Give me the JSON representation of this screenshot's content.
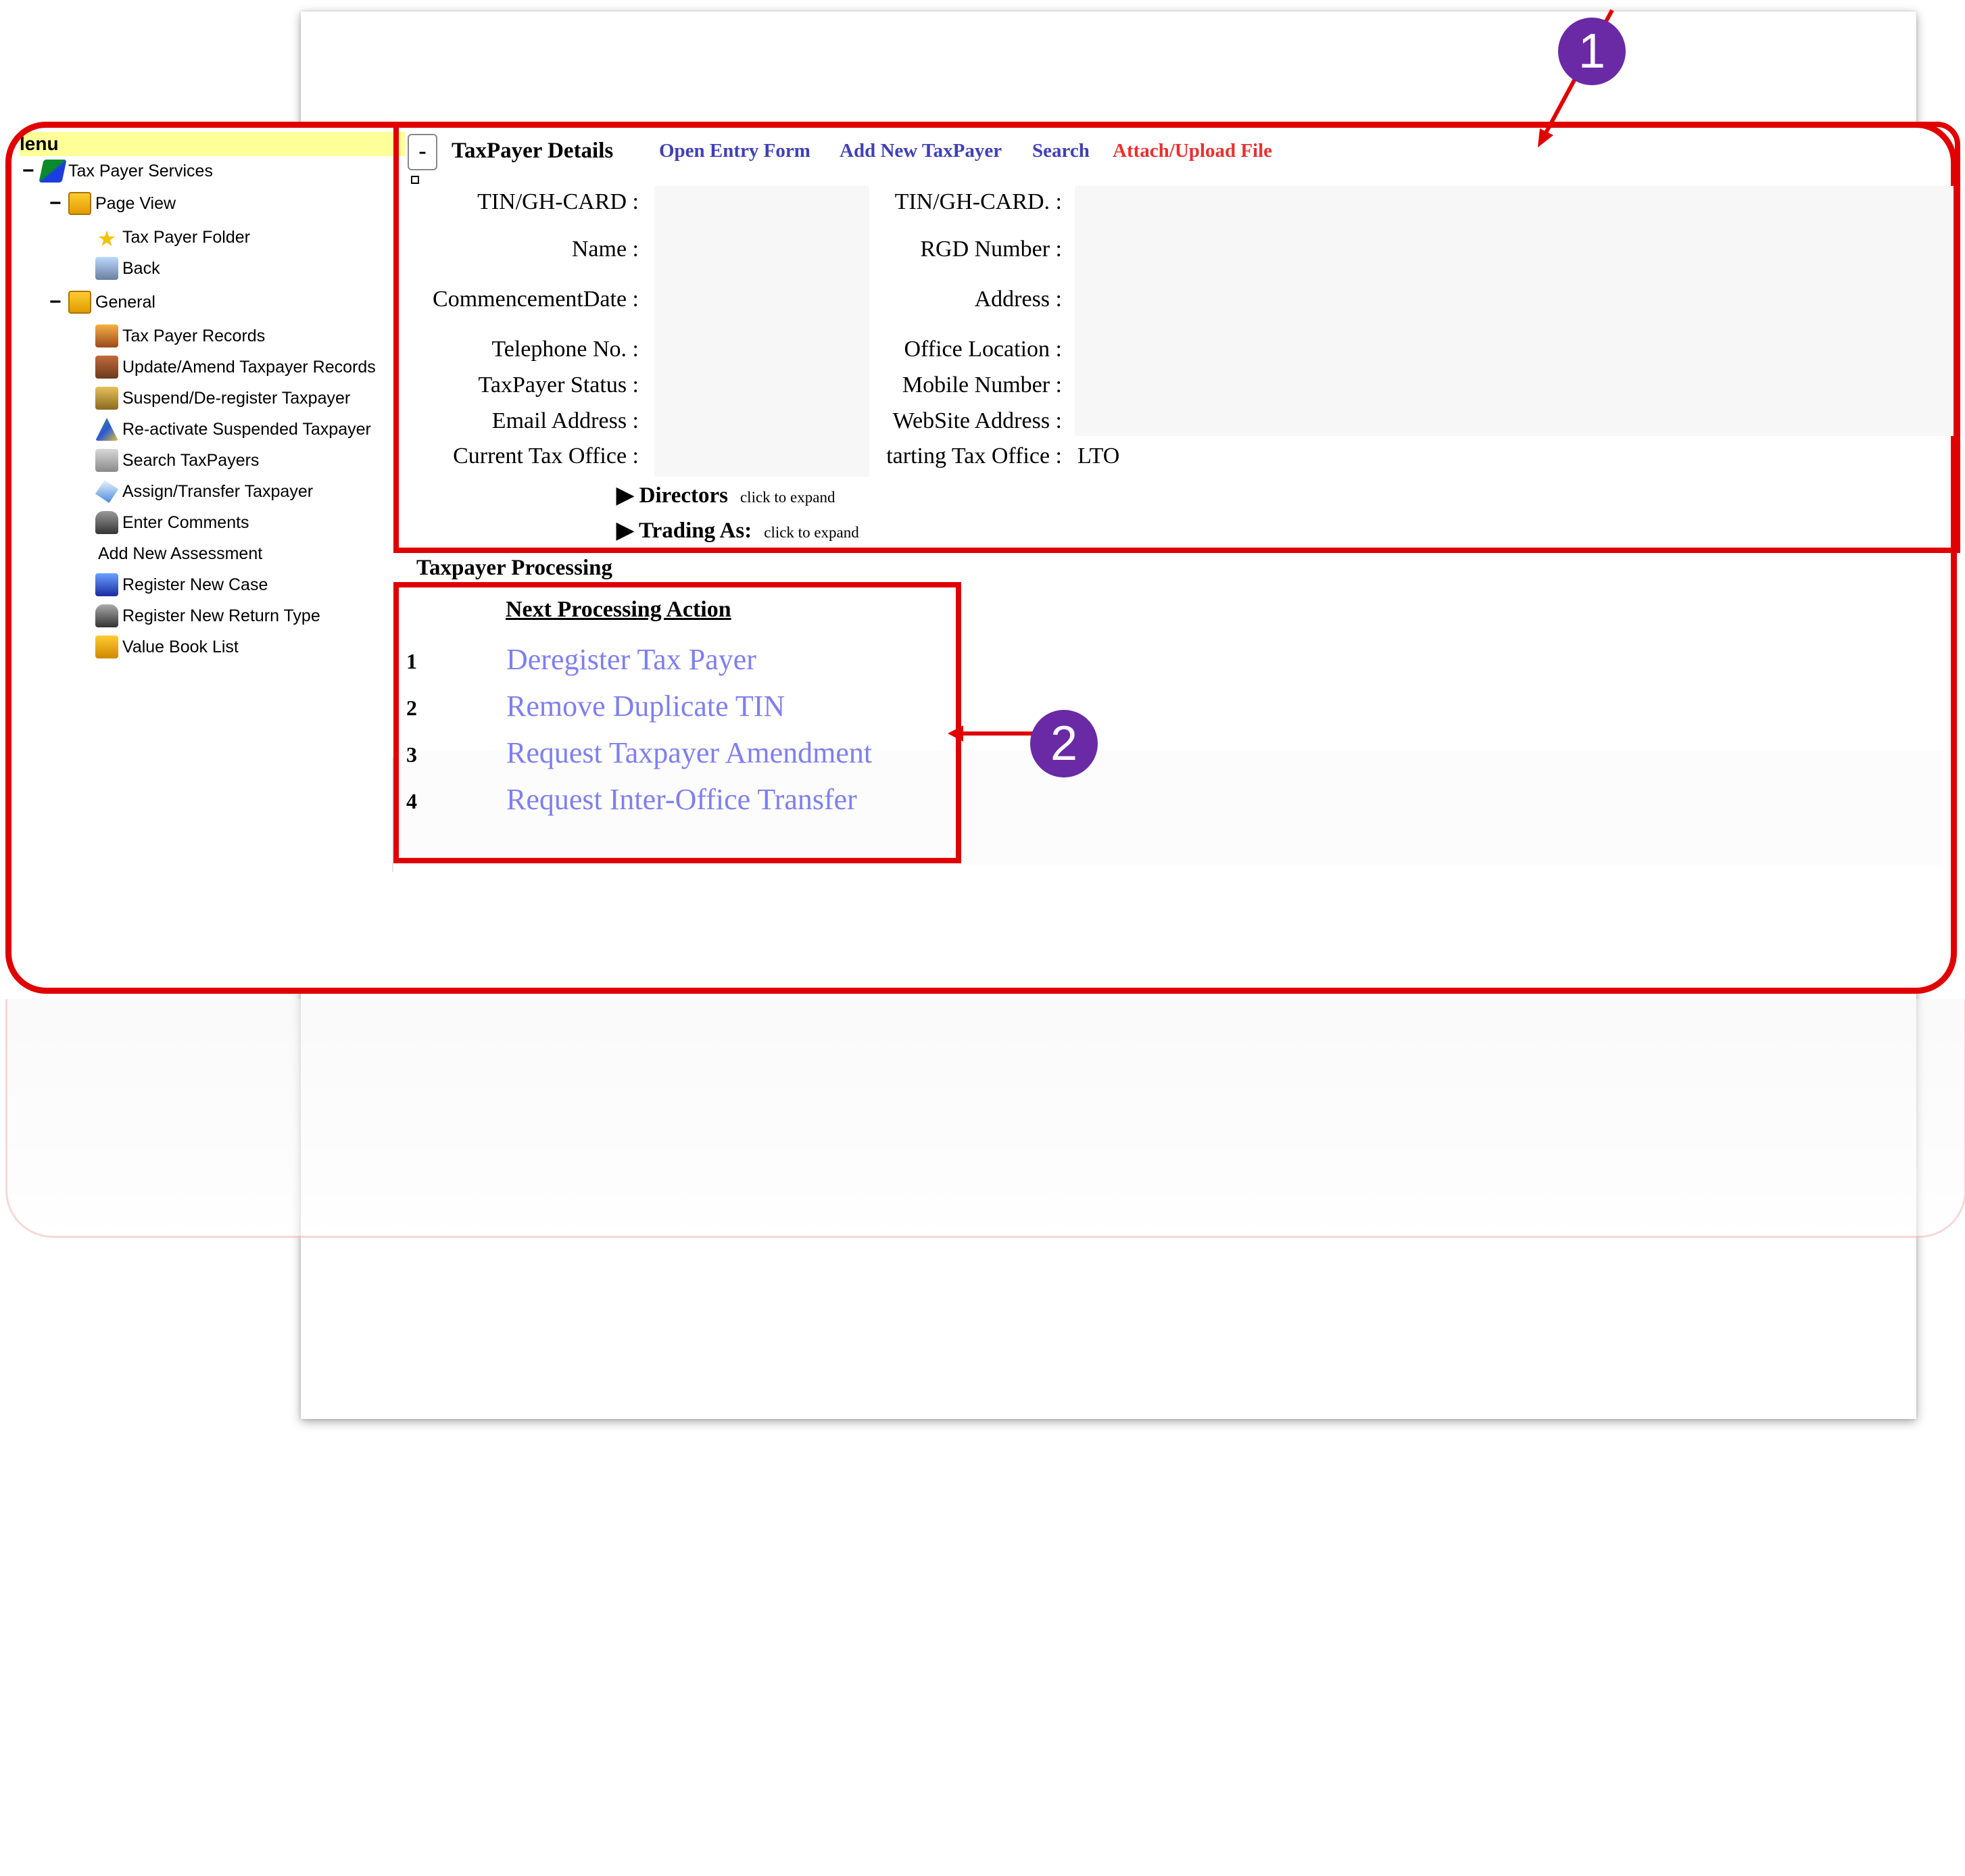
{
  "menu": {
    "title": "lenu",
    "items": [
      {
        "label": "Tax Payer Services",
        "toggle": "−",
        "icon": "book-icon"
      },
      {
        "label": "Page View",
        "toggle": "−",
        "icon": "folder-icon"
      },
      {
        "label": "Tax Payer Folder",
        "icon": "star-icon"
      },
      {
        "label": "Back",
        "icon": "back-icon"
      },
      {
        "label": "General",
        "toggle": "−",
        "icon": "folder-icon"
      },
      {
        "label": "Tax Payer Records",
        "icon": "records-icon"
      },
      {
        "label": "Update/Amend Taxpayer Records",
        "icon": "people-icon"
      },
      {
        "label": "Suspend/De-register Taxpayer",
        "icon": "lock-icon"
      },
      {
        "label": "Re-activate Suspended Taxpayer",
        "icon": "triangle-icon"
      },
      {
        "label": "Search TaxPayers",
        "icon": "search-icon"
      },
      {
        "label": "Assign/Transfer Taxpayer",
        "icon": "transfer-icon"
      },
      {
        "label": "Enter Comments",
        "icon": "comment-icon"
      },
      {
        "label": "Add New Assessment",
        "icon": ""
      },
      {
        "label": "Register New Case",
        "icon": "case-icon"
      },
      {
        "label": "Register New Return Type",
        "icon": "return-icon"
      },
      {
        "label": "Value Book List",
        "icon": "value-book-icon"
      }
    ]
  },
  "details": {
    "collapse_label": "-",
    "title": "TaxPayer Details",
    "links": {
      "open_entry": "Open Entry Form",
      "add_new": "Add New TaxPayer",
      "search": "Search",
      "attach": "Attach/Upload File"
    },
    "link_colors": {
      "normal": "#4040b8",
      "attach": "#e83030"
    },
    "left_labels": [
      "TIN/GH-CARD :",
      "Name :",
      "CommencementDate :",
      "Telephone No. :",
      "TaxPayer Status :",
      "Email Address :",
      "Current Tax Office :"
    ],
    "right_labels": [
      "TIN/GH-CARD. :",
      "RGD Number :",
      "Address :",
      "Office Location :",
      "Mobile Number :",
      "WebSite Address :",
      "tarting Tax Office :"
    ],
    "starting_tax_office_value": "LTO",
    "directors": {
      "label": "Directors",
      "hint": "click to expand"
    },
    "trading_as": {
      "label": "Trading As:",
      "hint": "click to expand"
    }
  },
  "processing": {
    "title": "Taxpayer Processing",
    "header": "Next Processing Action",
    "actions": [
      {
        "num": "1",
        "label": "Deregister Tax Payer"
      },
      {
        "num": "2",
        "label": "Remove Duplicate TIN"
      },
      {
        "num": "3",
        "label": "Request Taxpayer Amendment"
      },
      {
        "num": "4",
        "label": "Request Inter-Office Transfer"
      }
    ]
  },
  "callouts": {
    "one": "1",
    "two": "2",
    "accent": "#e00000",
    "badge_color": "#6a2aa6"
  }
}
